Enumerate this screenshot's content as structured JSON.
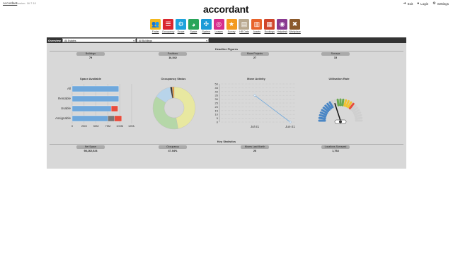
{
  "app": {
    "name": "Accordant",
    "version": "Version: 16.7.10",
    "logo_text": "accordant"
  },
  "top_links": [
    {
      "icon": "exit-icon",
      "label": "Exit"
    },
    {
      "icon": "user-icon",
      "label": "Login"
    },
    {
      "icon": "gear-icon",
      "label": "Settings"
    }
  ],
  "modules": [
    {
      "label": "Finder",
      "color": "#f3b81e",
      "icon": "finder-icon",
      "glyph": "👥"
    },
    {
      "label": "Occupancy",
      "color": "#d9272e",
      "icon": "occupancy-icon",
      "glyph": "☰"
    },
    {
      "label": "Scope",
      "color": "#1ea3dc",
      "icon": "scope-icon",
      "glyph": "⚙"
    },
    {
      "label": "Space",
      "color": "#2aa55a",
      "icon": "space-icon",
      "glyph": "◕"
    },
    {
      "label": "System",
      "color": "#1b9bd7",
      "icon": "system-icon",
      "glyph": "✣"
    },
    {
      "label": "Leases",
      "color": "#d62e8c",
      "icon": "leases-icon",
      "glyph": "◎"
    },
    {
      "label": "Survey",
      "color": "#f39a1f",
      "icon": "survey-icon",
      "glyph": "★"
    },
    {
      "label": "HR Data",
      "color": "#b8a88e",
      "icon": "hr-data-icon",
      "glyph": "▤"
    },
    {
      "label": "Assets",
      "color": "#e8632b",
      "icon": "assets-icon",
      "glyph": "▥"
    },
    {
      "label": "Bookings",
      "color": "#d0452a",
      "icon": "bookings-icon",
      "glyph": "▦"
    },
    {
      "label": "Helpdesk",
      "color": "#8a3a8f",
      "icon": "helpdesk-icon",
      "glyph": "◉"
    },
    {
      "label": "Workplace",
      "color": "#8b5a2b",
      "icon": "workplace-icon",
      "glyph": "✖"
    }
  ],
  "filters": {
    "label": "Overview",
    "primary": {
      "value": "All Estates"
    },
    "secondary": {
      "value": "All Buildings"
    }
  },
  "headline": {
    "title": "Headline Figures",
    "items": [
      {
        "caption": "Buildings",
        "value": "79"
      },
      {
        "caption": "Positions",
        "value": "16,542"
      },
      {
        "caption": "Move Projects",
        "value": "27"
      },
      {
        "caption": "Surveys",
        "value": "15"
      }
    ]
  },
  "key_stats": {
    "title": "Key Statistics",
    "items": [
      {
        "caption": "Net Space",
        "value": "98,162,024"
      },
      {
        "caption": "Occupancy",
        "value": "47.04%"
      },
      {
        "caption": "Moves Last Month",
        "value": "26"
      },
      {
        "caption": "Locations Surveyed",
        "value": "1,764"
      }
    ]
  },
  "chart_data": [
    {
      "type": "bar",
      "title": "Space Available",
      "orientation": "horizontal",
      "stacked": true,
      "categories": [
        "All",
        "Rentable",
        "Usable",
        "Assignable"
      ],
      "series": [
        {
          "color": "#6fa8dc",
          "values": [
            98,
            98,
            82,
            75
          ]
        },
        {
          "color": "#777777",
          "values": [
            0,
            0,
            0,
            14
          ]
        },
        {
          "color": "#e74c3c",
          "values": [
            0,
            0,
            14,
            15
          ]
        }
      ],
      "xlim": [
        0,
        125
      ],
      "xticks": [
        "0",
        "25M",
        "50M",
        "75M",
        "100M",
        "125M"
      ],
      "grid": true
    },
    {
      "type": "pie",
      "title": "Occupancy Status",
      "donut": true,
      "slices": [
        {
          "value": 47,
          "color": "#e8e8a0"
        },
        {
          "value": 37,
          "color": "#b5d7a8"
        },
        {
          "value": 13,
          "color": "#b8d4ea"
        },
        {
          "value": 1.5,
          "color": "#333333"
        },
        {
          "value": 1.5,
          "color": "#e69a3a"
        }
      ]
    },
    {
      "type": "line",
      "title": "Move Activity",
      "x": [
        "Jul-21",
        "Jun-21"
      ],
      "values": [
        35,
        0
      ],
      "ylim": [
        0,
        50
      ],
      "yticks": [
        "0",
        "5",
        "10",
        "15",
        "20",
        "25",
        "30",
        "35",
        "40",
        "45",
        "50"
      ],
      "color": "#6fa8dc",
      "grid": true
    },
    {
      "type": "gauge",
      "title": "Utilisation Rate",
      "value": 40,
      "range": [
        0,
        100
      ]
    }
  ]
}
